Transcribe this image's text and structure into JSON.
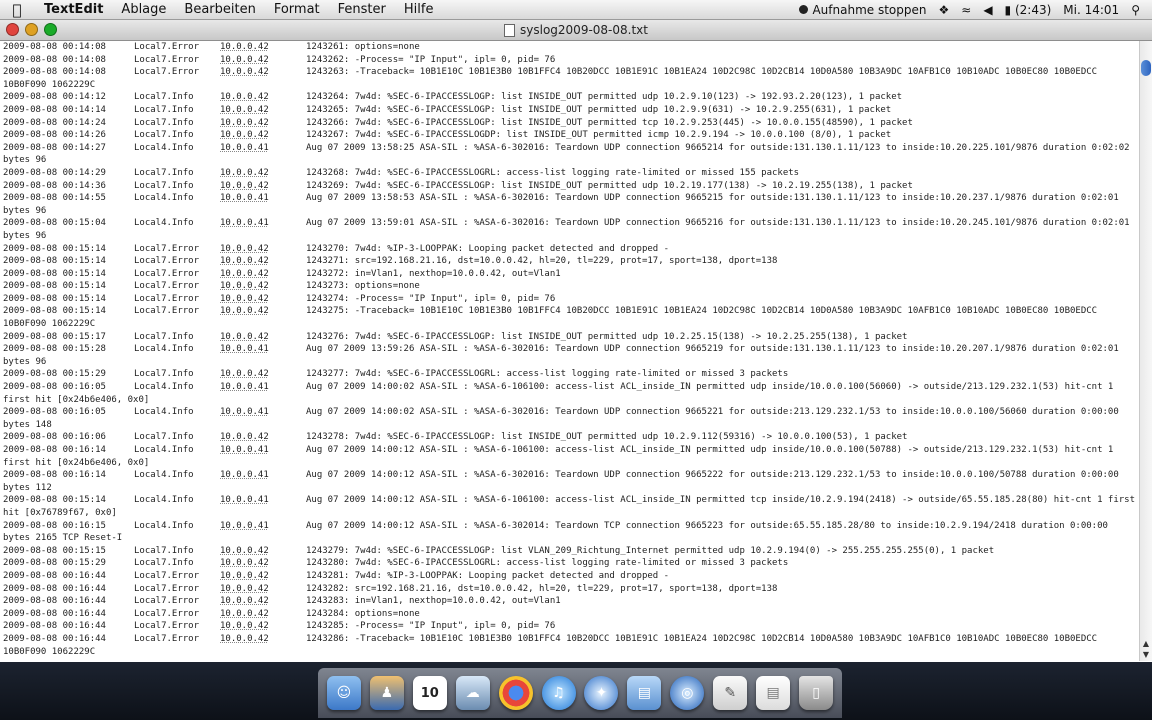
{
  "menubar": {
    "app_name": "TextEdit",
    "menus": [
      "Ablage",
      "Bearbeiten",
      "Format",
      "Fenster",
      "Hilfe"
    ],
    "recording_label": "Aufnahme stoppen",
    "battery_time": "(2:43)",
    "clock": "Mi. 14:01"
  },
  "window": {
    "title": "syslog2009-08-08.txt"
  },
  "scrollbar": {
    "position_fraction": 0.97
  },
  "log_lines": [
    {
      "ts": "2009-08-08 00:14:08",
      "src": "Local7.Error",
      "ip": "10.0.0.42",
      "msg": "1243261: options=none"
    },
    {
      "ts": "2009-08-08 00:14:08",
      "src": "Local7.Error",
      "ip": "10.0.0.42",
      "msg": "1243262: -Process= \"IP Input\", ipl= 0, pid= 76"
    },
    {
      "ts": "2009-08-08 00:14:08",
      "src": "Local7.Error",
      "ip": "10.0.0.42",
      "msg": "1243263: -Traceback= 10B1E10C 10B1E3B0 10B1FFC4 10B20DCC 10B1E91C 10B1EA24 10D2C98C 10D2CB14 10D0A580 10B3A9DC 10AFB1C0 10B10ADC 10B0EC80 10B0EDCC"
    },
    {
      "cont": "10B0F090 1062229C"
    },
    {
      "ts": "2009-08-08 00:14:12",
      "src": "Local7.Info",
      "ip": "10.0.0.42",
      "msg": "1243264: 7w4d: %SEC-6-IPACCESSLOGP: list INSIDE_OUT permitted udp 10.2.9.10(123) -> 192.93.2.20(123), 1 packet"
    },
    {
      "ts": "2009-08-08 00:14:14",
      "src": "Local7.Info",
      "ip": "10.0.0.42",
      "msg": "1243265: 7w4d: %SEC-6-IPACCESSLOGP: list INSIDE_OUT permitted udp 10.2.9.9(631) -> 10.2.9.255(631), 1 packet"
    },
    {
      "ts": "2009-08-08 00:14:24",
      "src": "Local7.Info",
      "ip": "10.0.0.42",
      "msg": "1243266: 7w4d: %SEC-6-IPACCESSLOGP: list INSIDE_OUT permitted tcp 10.2.9.253(445) -> 10.0.0.155(48590), 1 packet"
    },
    {
      "ts": "2009-08-08 00:14:26",
      "src": "Local7.Info",
      "ip": "10.0.0.42",
      "msg": "1243267: 7w4d: %SEC-6-IPACCESSLOGDP: list INSIDE_OUT permitted icmp 10.2.9.194 -> 10.0.0.100 (8/0), 1 packet"
    },
    {
      "ts": "2009-08-08 00:14:27",
      "src": "Local4.Info",
      "ip": "10.0.0.41",
      "msg": "Aug 07 2009 13:58:25 ASA-SIL : %ASA-6-302016: Teardown UDP connection 9665214 for outside:131.130.1.11/123 to inside:10.20.225.101/9876 duration 0:02:02"
    },
    {
      "cont": "bytes 96"
    },
    {
      "ts": "2009-08-08 00:14:29",
      "src": "Local7.Info",
      "ip": "10.0.0.42",
      "msg": "1243268: 7w4d: %SEC-6-IPACCESSLOGRL: access-list logging rate-limited or missed 155 packets"
    },
    {
      "ts": "2009-08-08 00:14:36",
      "src": "Local7.Info",
      "ip": "10.0.0.42",
      "msg": "1243269: 7w4d: %SEC-6-IPACCESSLOGP: list INSIDE_OUT permitted udp 10.2.19.177(138) -> 10.2.19.255(138), 1 packet"
    },
    {
      "ts": "2009-08-08 00:14:55",
      "src": "Local4.Info",
      "ip": "10.0.0.41",
      "msg": "Aug 07 2009 13:58:53 ASA-SIL : %ASA-6-302016: Teardown UDP connection 9665215 for outside:131.130.1.11/123 to inside:10.20.237.1/9876 duration 0:02:01"
    },
    {
      "cont": "bytes 96"
    },
    {
      "ts": "2009-08-08 00:15:04",
      "src": "Local4.Info",
      "ip": "10.0.0.41",
      "msg": "Aug 07 2009 13:59:01 ASA-SIL : %ASA-6-302016: Teardown UDP connection 9665216 for outside:131.130.1.11/123 to inside:10.20.245.101/9876 duration 0:02:01"
    },
    {
      "cont": "bytes 96"
    },
    {
      "ts": "2009-08-08 00:15:14",
      "src": "Local7.Error",
      "ip": "10.0.0.42",
      "msg": "1243270: 7w4d: %IP-3-LOOPPAK: Looping packet detected and dropped -"
    },
    {
      "ts": "2009-08-08 00:15:14",
      "src": "Local7.Error",
      "ip": "10.0.0.42",
      "msg": "1243271: src=192.168.21.16, dst=10.0.0.42, hl=20, tl=229, prot=17, sport=138, dport=138"
    },
    {
      "ts": "2009-08-08 00:15:14",
      "src": "Local7.Error",
      "ip": "10.0.0.42",
      "msg": "1243272: in=Vlan1, nexthop=10.0.0.42, out=Vlan1"
    },
    {
      "ts": "2009-08-08 00:15:14",
      "src": "Local7.Error",
      "ip": "10.0.0.42",
      "msg": "1243273: options=none"
    },
    {
      "ts": "2009-08-08 00:15:14",
      "src": "Local7.Error",
      "ip": "10.0.0.42",
      "msg": "1243274: -Process= \"IP Input\", ipl= 0, pid= 76"
    },
    {
      "ts": "2009-08-08 00:15:14",
      "src": "Local7.Error",
      "ip": "10.0.0.42",
      "msg": "1243275: -Traceback= 10B1E10C 10B1E3B0 10B1FFC4 10B20DCC 10B1E91C 10B1EA24 10D2C98C 10D2CB14 10D0A580 10B3A9DC 10AFB1C0 10B10ADC 10B0EC80 10B0EDCC"
    },
    {
      "cont": "10B0F090 1062229C"
    },
    {
      "ts": "2009-08-08 00:15:17",
      "src": "Local7.Info",
      "ip": "10.0.0.42",
      "msg": "1243276: 7w4d: %SEC-6-IPACCESSLOGP: list INSIDE_OUT permitted udp 10.2.25.15(138) -> 10.2.25.255(138), 1 packet"
    },
    {
      "ts": "2009-08-08 00:15:28",
      "src": "Local4.Info",
      "ip": "10.0.0.41",
      "msg": "Aug 07 2009 13:59:26 ASA-SIL : %ASA-6-302016: Teardown UDP connection 9665219 for outside:131.130.1.11/123 to inside:10.20.207.1/9876 duration 0:02:01"
    },
    {
      "cont": "bytes 96"
    },
    {
      "ts": "2009-08-08 00:15:29",
      "src": "Local7.Info",
      "ip": "10.0.0.42",
      "msg": "1243277: 7w4d: %SEC-6-IPACCESSLOGRL: access-list logging rate-limited or missed 3 packets"
    },
    {
      "ts": "2009-08-08 00:16:05",
      "src": "Local4.Info",
      "ip": "10.0.0.41",
      "msg": "Aug 07 2009 14:00:02 ASA-SIL : %ASA-6-106100: access-list ACL_inside_IN permitted udp inside/10.0.0.100(56060) -> outside/213.129.232.1(53) hit-cnt 1"
    },
    {
      "cont": "first hit [0x24b6e406, 0x0]"
    },
    {
      "ts": "2009-08-08 00:16:05",
      "src": "Local4.Info",
      "ip": "10.0.0.41",
      "msg": "Aug 07 2009 14:00:02 ASA-SIL : %ASA-6-302016: Teardown UDP connection 9665221 for outside:213.129.232.1/53 to inside:10.0.0.100/56060 duration 0:00:00"
    },
    {
      "cont": "bytes 148"
    },
    {
      "ts": "2009-08-08 00:16:06",
      "src": "Local7.Info",
      "ip": "10.0.0.42",
      "msg": "1243278: 7w4d: %SEC-6-IPACCESSLOGP: list INSIDE_OUT permitted udp 10.2.9.112(59316) -> 10.0.0.100(53), 1 packet"
    },
    {
      "ts": "2009-08-08 00:16:14",
      "src": "Local4.Info",
      "ip": "10.0.0.41",
      "msg": "Aug 07 2009 14:00:12 ASA-SIL : %ASA-6-106100: access-list ACL_inside_IN permitted udp inside/10.0.0.100(50788) -> outside/213.129.232.1(53) hit-cnt 1"
    },
    {
      "cont": "first hit [0x24b6e406, 0x0]"
    },
    {
      "ts": "2009-08-08 00:16:14",
      "src": "Local4.Info",
      "ip": "10.0.0.41",
      "msg": "Aug 07 2009 14:00:12 ASA-SIL : %ASA-6-302016: Teardown UDP connection 9665222 for outside:213.129.232.1/53 to inside:10.0.0.100/50788 duration 0:00:00"
    },
    {
      "cont": "bytes 112"
    },
    {
      "ts": "2009-08-08 00:15:14",
      "src": "Local4.Info",
      "ip": "10.0.0.41",
      "msg": "Aug 07 2009 14:00:12 ASA-SIL : %ASA-6-106100: access-list ACL_inside_IN permitted tcp inside/10.2.9.194(2418) -> outside/65.55.185.28(80) hit-cnt 1 first"
    },
    {
      "cont": "hit [0x76789f67, 0x0]"
    },
    {
      "ts": "2009-08-08 00:16:15",
      "src": "Local4.Info",
      "ip": "10.0.0.41",
      "msg": "Aug 07 2009 14:00:12 ASA-SIL : %ASA-6-302014: Teardown TCP connection 9665223 for outside:65.55.185.28/80 to inside:10.2.9.194/2418 duration 0:00:00"
    },
    {
      "cont": "bytes 2165 TCP Reset-I"
    },
    {
      "ts": "2009-08-08 00:15:15",
      "src": "Local7.Info",
      "ip": "10.0.0.42",
      "msg": "1243279: 7w4d: %SEC-6-IPACCESSLOGP: list VLAN_209_Richtung_Internet permitted udp 10.2.9.194(0) -> 255.255.255.255(0), 1 packet"
    },
    {
      "ts": "2009-08-08 00:15:29",
      "src": "Local7.Info",
      "ip": "10.0.0.42",
      "msg": "1243280: 7w4d: %SEC-6-IPACCESSLOGRL: access-list logging rate-limited or missed 3 packets"
    },
    {
      "ts": "2009-08-08 00:16:44",
      "src": "Local7.Error",
      "ip": "10.0.0.42",
      "msg": "1243281: 7w4d: %IP-3-LOOPPAK: Looping packet detected and dropped -"
    },
    {
      "ts": "2009-08-08 00:16:44",
      "src": "Local7.Error",
      "ip": "10.0.0.42",
      "msg": "1243282: src=192.168.21.16, dst=10.0.0.42, hl=20, tl=229, prot=17, sport=138, dport=138"
    },
    {
      "ts": "2009-08-08 00:16:44",
      "src": "Local7.Error",
      "ip": "10.0.0.42",
      "msg": "1243283: in=Vlan1, nexthop=10.0.0.42, out=Vlan1"
    },
    {
      "ts": "2009-08-08 00:16:44",
      "src": "Local7.Error",
      "ip": "10.0.0.42",
      "msg": "1243284: options=none"
    },
    {
      "ts": "2009-08-08 00:16:44",
      "src": "Local7.Error",
      "ip": "10.0.0.42",
      "msg": "1243285: -Process= \"IP Input\", ipl= 0, pid= 76"
    },
    {
      "ts": "2009-08-08 00:16:44",
      "src": "Local7.Error",
      "ip": "10.0.0.42",
      "msg": "1243286: -Traceback= 10B1E10C 10B1E3B0 10B1FFC4 10B20DCC 10B1E91C 10B1EA24 10D2C98C 10D2CB14 10D0A580 10B3A9DC 10AFB1C0 10B10ADC 10B0EC80 10B0EDCC"
    },
    {
      "cont": "10B0F090 1062229C"
    }
  ],
  "dock": {
    "calendar_day": "10",
    "icons": [
      "finder-icon",
      "user-icon",
      "calendar-icon",
      "preview-icon",
      "chrome-icon",
      "itunes-icon",
      "safari-icon",
      "folder-icon",
      "safari-icon",
      "textedit-icon",
      "document-icon",
      "trash-icon"
    ]
  },
  "colors": {
    "menubar_bg": "#e6e6e6",
    "document_bg": "#ffffff",
    "scroll_thumb": "#3a74cc"
  }
}
